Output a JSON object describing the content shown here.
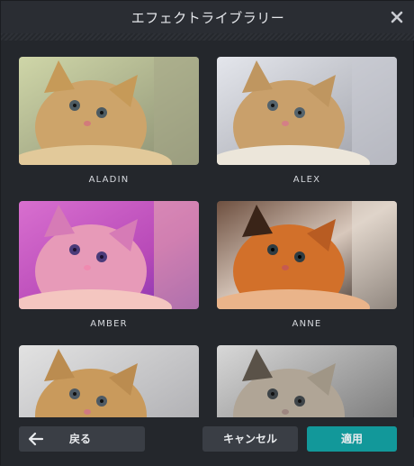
{
  "dialog": {
    "title": "エフェクトライブラリー",
    "close_icon": "close-icon"
  },
  "effects": [
    {
      "label": "ALADIN"
    },
    {
      "label": "ALEX"
    },
    {
      "label": "AMBER"
    },
    {
      "label": "ANNE"
    },
    {
      "label": ""
    },
    {
      "label": ""
    }
  ],
  "footer": {
    "back_label": "戻る",
    "back_icon": "arrow-left-icon",
    "cancel_label": "キャンセル",
    "apply_label": "適用"
  },
  "colors": {
    "apply_button": "#12989a",
    "secondary_button": "#3a3e45",
    "background": "#24272c"
  }
}
